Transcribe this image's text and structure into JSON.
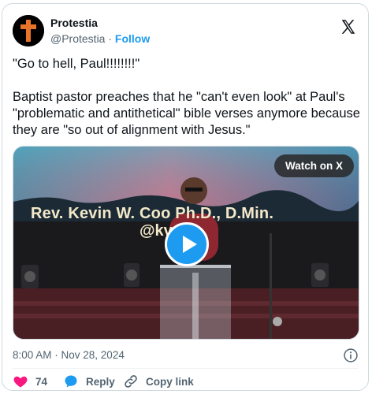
{
  "author": {
    "display_name": "Protestia",
    "handle": "@Protestia",
    "separator": " · ",
    "follow_label": "Follow"
  },
  "tweet": {
    "line1": "\"Go to hell, Paul!!!!!!!!\"",
    "line2": "Baptist pastor preaches that he \"can't even look\" at Paul's \"problematic and antithetical\" bible verses anymore because they are \"so out of alignment with Jesus.\""
  },
  "media": {
    "watch_label": "Watch on X",
    "banner_line1": "Rev. Kevin W. Coo     Ph.D., D.Min.",
    "banner_line2": "@kv"
  },
  "meta": {
    "timestamp": "8:00 AM · Nov 28, 2024"
  },
  "actions": {
    "like_count": "74",
    "reply_label": "Reply",
    "copy_label": "Copy link"
  },
  "colors": {
    "accent": "#1d9bf0",
    "like": "#f91880",
    "text": "#0f1419",
    "secondary": "#536471"
  },
  "icons": [
    "cross-avatar-icon",
    "x-logo-icon",
    "play-icon",
    "info-icon",
    "heart-icon",
    "reply-bubble-icon",
    "link-icon"
  ]
}
